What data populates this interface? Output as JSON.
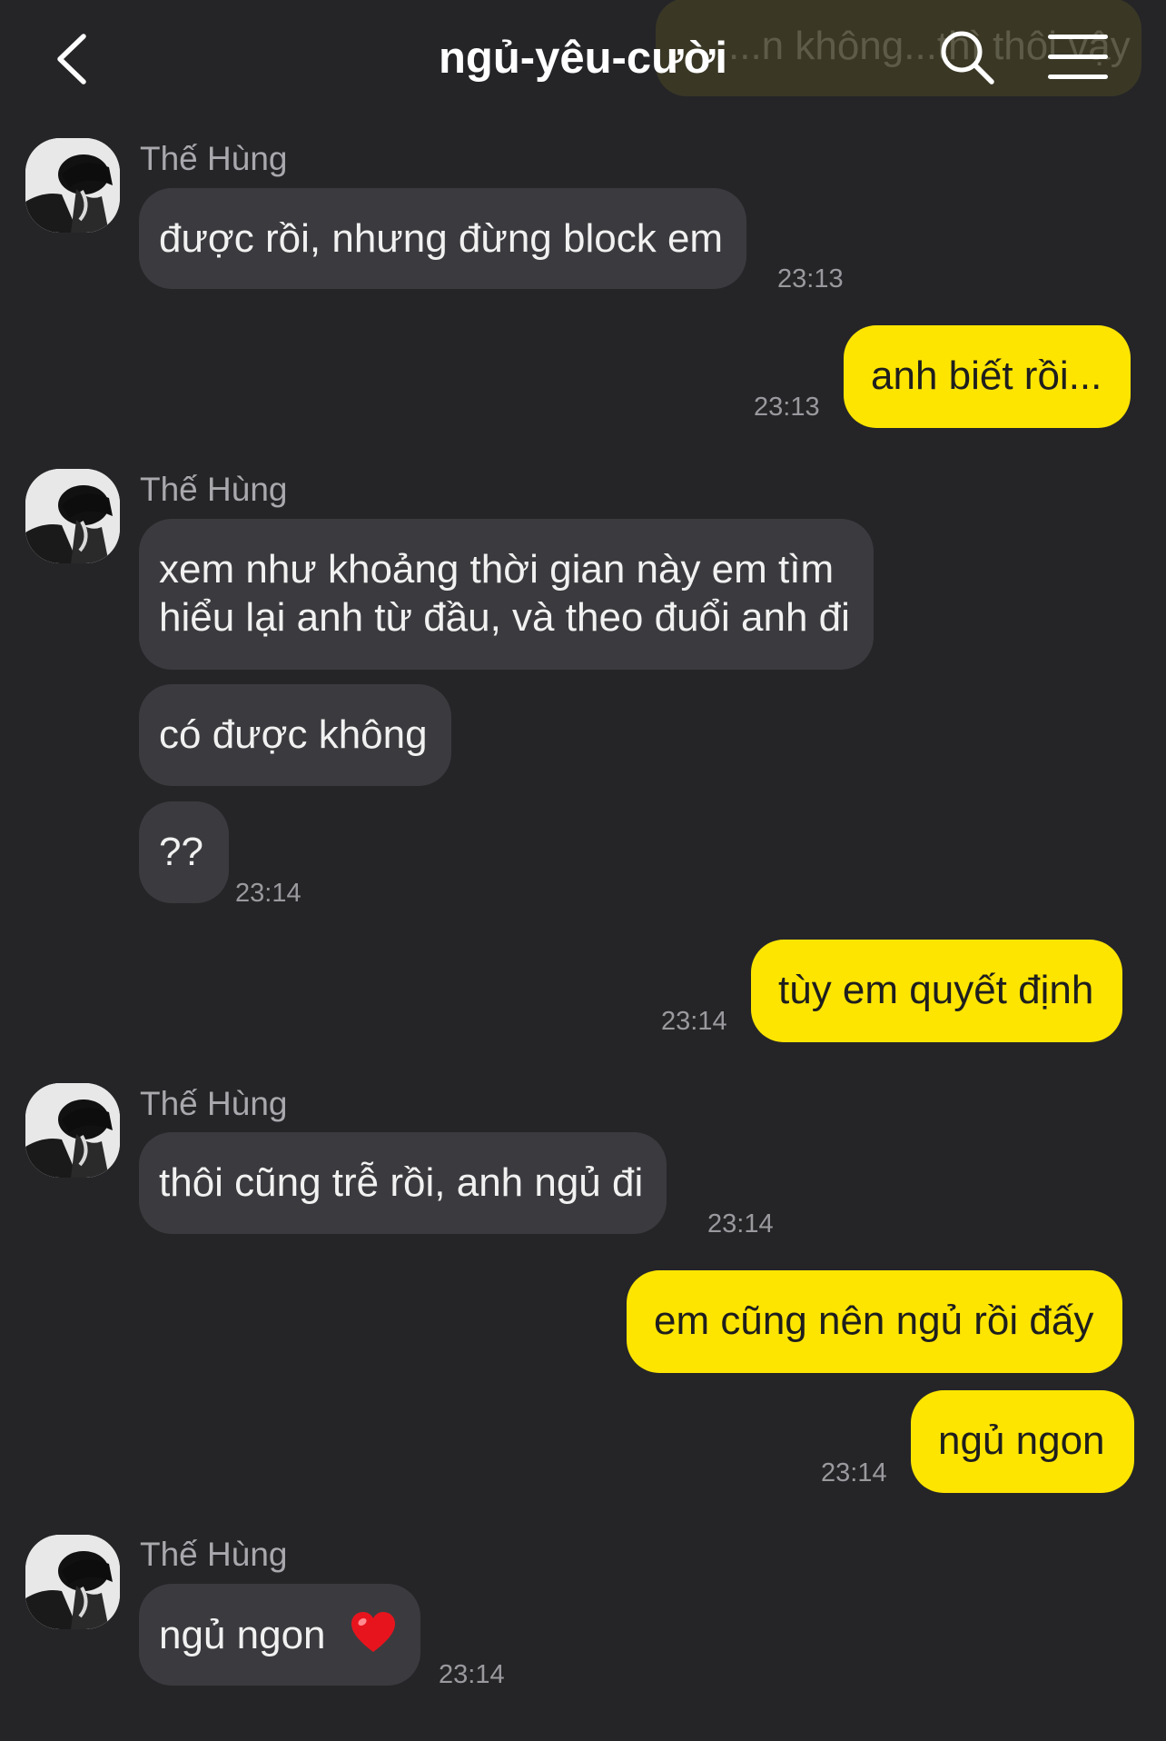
{
  "header": {
    "title": "ngủ-yêu-cười",
    "ghost_text": "...n không...thì thôi vậy"
  },
  "colors": {
    "background": "#252528",
    "incoming_bubble": "#3b3b3f",
    "outgoing_bubble": "#fee500"
  },
  "icons": {
    "back": "chevron-left-icon",
    "search": "search-icon",
    "menu": "hamburger-menu-icon",
    "heart": "red-heart-icon"
  },
  "messages": [
    {
      "sender": "Thế Hùng",
      "text": "được rồi, nhưng đừng block em",
      "time": "23:13"
    },
    {
      "text": "anh biết rồi...",
      "time": "23:13"
    },
    {
      "sender": "Thế Hùng",
      "text_line1": "xem như khoảng thời gian này em tìm",
      "text_line2": "hiểu lại anh từ đầu, và theo đuổi anh đi"
    },
    {
      "text": "có được không"
    },
    {
      "text": "??",
      "time": "23:14"
    },
    {
      "text": "tùy em quyết định",
      "time": "23:14"
    },
    {
      "sender": "Thế Hùng",
      "text": "thôi cũng trễ rồi, anh ngủ đi",
      "time": "23:14"
    },
    {
      "text": "em cũng nên ngủ rồi đấy"
    },
    {
      "text": "ngủ ngon",
      "time": "23:14"
    },
    {
      "sender": "Thế Hùng",
      "text": "ngủ ngon",
      "time": "23:14"
    }
  ]
}
